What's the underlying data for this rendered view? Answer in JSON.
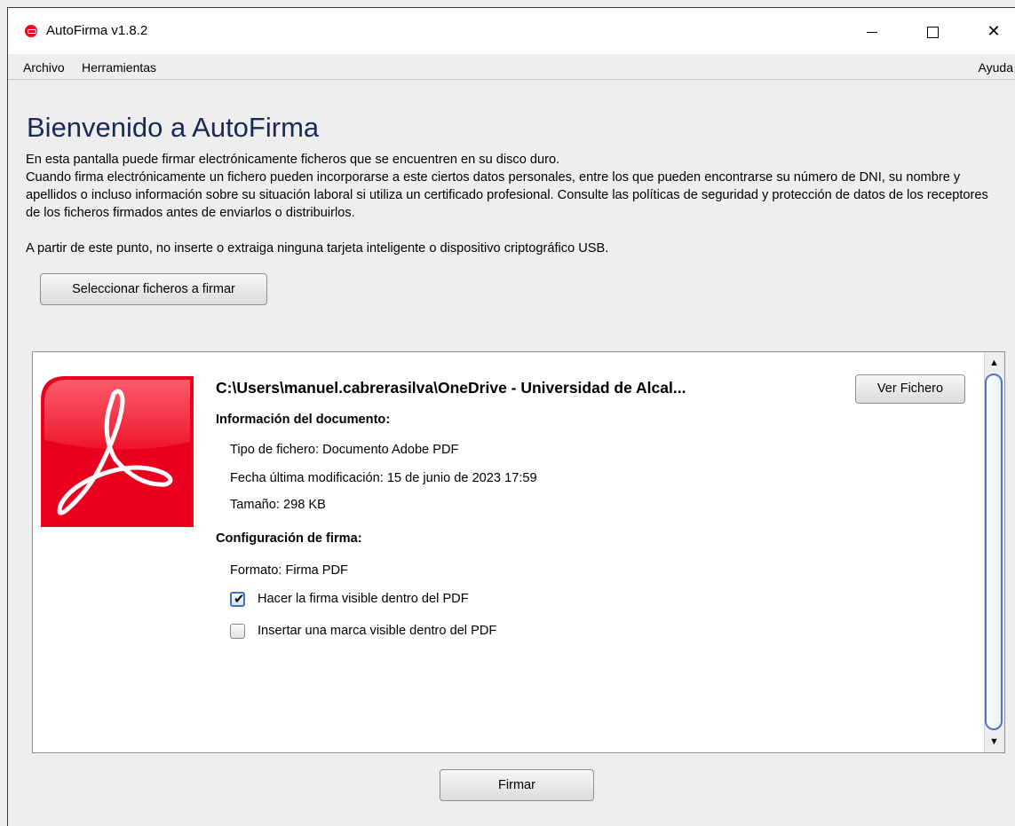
{
  "window": {
    "title": "AutoFirma v1.8.2"
  },
  "menu": {
    "archivo": "Archivo",
    "herramientas": "Herramientas",
    "ayuda": "Ayuda"
  },
  "main": {
    "heading": "Bienvenido a AutoFirma",
    "para1": "En esta pantalla puede firmar electrónicamente ficheros que se encuentren en su disco duro.",
    "para2": "Cuando firma electrónicamente un fichero pueden incorporarse a este ciertos datos personales, entre los que pueden encontrarse su número de DNI, su nombre y apellidos o incluso información sobre su situación laboral si utiliza un certificado profesional. Consulte las políticas de seguridad y protección de datos de los receptores de los ficheros firmados antes de enviarlos o distribuirlos.",
    "para3": "A partir de este punto, no inserte o extraiga ninguna tarjeta inteligente o dispositivo criptográfico USB.",
    "select_button": "Seleccionar ficheros a firmar",
    "sign_button": "Firmar"
  },
  "file_panel": {
    "path": "C:\\Users\\manuel.cabrerasilva\\OneDrive - Universidad de Alcal...",
    "view_button": "Ver Fichero",
    "doc_info_heading": "Información del documento:",
    "file_type": "Tipo de fichero: Documento Adobe PDF",
    "modified": "Fecha última modificación: 15 de junio de 2023 17:59",
    "size": "Tamaño: 298 KB",
    "sign_config_heading": "Configuración de firma:",
    "format": "Formato: Firma PDF",
    "visible_signature": {
      "label": "Hacer la firma visible dentro del PDF",
      "checked": true
    },
    "visible_mark": {
      "label": "Insertar una marca visible dentro del PDF",
      "checked": false
    },
    "icon": "adobe-pdf-icon"
  },
  "colors": {
    "heading": "#1a2a55",
    "pdf_red": "#e8001e",
    "accent": "#3f6fcf"
  }
}
